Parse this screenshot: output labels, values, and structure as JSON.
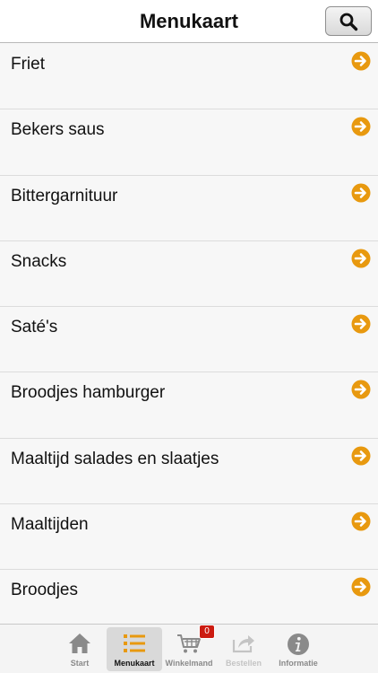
{
  "header": {
    "title": "Menukaart",
    "search_icon": "search-icon"
  },
  "colors": {
    "accent_orange": "#e8990f",
    "badge_red": "#cc1b10"
  },
  "menu": {
    "items": [
      {
        "label": "Friet"
      },
      {
        "label": "Bekers saus"
      },
      {
        "label": "Bittergarnituur"
      },
      {
        "label": "Snacks"
      },
      {
        "label": "Saté's"
      },
      {
        "label": "Broodjes hamburger"
      },
      {
        "label": "Maaltijd salades en slaatjes"
      },
      {
        "label": "Maaltijden"
      },
      {
        "label": "Broodjes"
      }
    ]
  },
  "tabbar": {
    "tabs": [
      {
        "label": "Start",
        "icon": "home-icon"
      },
      {
        "label": "Menukaart",
        "icon": "list-icon"
      },
      {
        "label": "Winkelmand",
        "icon": "cart-icon",
        "badge": "0"
      },
      {
        "label": "Bestellen",
        "icon": "share-icon"
      },
      {
        "label": "Informatie",
        "icon": "info-icon"
      }
    ]
  }
}
